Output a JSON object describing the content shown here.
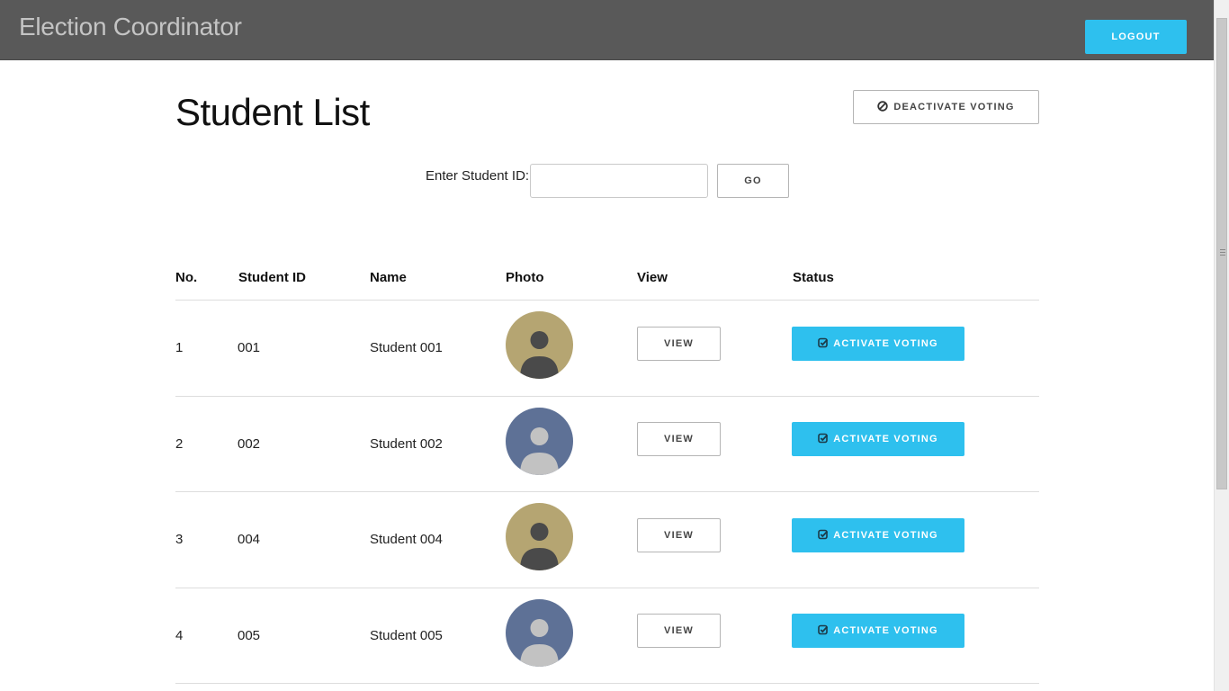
{
  "app": {
    "title": "Election Coordinator",
    "logout_label": "LOGOUT"
  },
  "page": {
    "title": "Student List",
    "deactivate_label": "DEACTIVATE VOTING",
    "search": {
      "label": "Enter Student ID:",
      "value": "",
      "placeholder": "",
      "go_label": "GO"
    }
  },
  "table": {
    "headers": {
      "no": "No.",
      "student_id": "Student ID",
      "name": "Name",
      "photo": "Photo",
      "view": "View",
      "status": "Status"
    },
    "rows": [
      {
        "no": "1",
        "student_id": "001",
        "name": "Student 001",
        "avatar": "dark-on-tan",
        "view_label": "VIEW",
        "status_label": "ACTIVATE VOTING"
      },
      {
        "no": "2",
        "student_id": "002",
        "name": "Student 002",
        "avatar": "light-on-blue",
        "view_label": "VIEW",
        "status_label": "ACTIVATE VOTING"
      },
      {
        "no": "3",
        "student_id": "004",
        "name": "Student 004",
        "avatar": "dark-on-tan",
        "view_label": "VIEW",
        "status_label": "ACTIVATE VOTING"
      },
      {
        "no": "4",
        "student_id": "005",
        "name": "Student 005",
        "avatar": "light-on-blue",
        "view_label": "VIEW",
        "status_label": "ACTIVATE VOTING"
      }
    ]
  },
  "icons": {
    "deactivate": "ban-icon",
    "activate": "check-square-icon",
    "avatar": "person-silhouette-icon"
  },
  "colors": {
    "topbar": "#595959",
    "brand_text": "#c4c4c4",
    "accent": "#2ec0ee",
    "avatar_tan": "#b5a572",
    "avatar_tan_figure": "#4a4a4a",
    "avatar_blue": "#5e7196",
    "avatar_blue_figure": "#c2c2c2"
  }
}
